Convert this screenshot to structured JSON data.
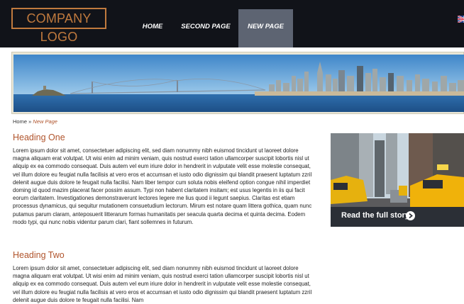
{
  "header": {
    "logo_text": "COMPANY LOGO",
    "nav": [
      {
        "label": "HOME",
        "active": false
      },
      {
        "label": "SECOND PAGE",
        "active": false
      },
      {
        "label": "NEW PAGE",
        "active": true
      }
    ],
    "language_icon": "uk-flag-icon"
  },
  "banner": {
    "image": "city-skyline-bay-bridge"
  },
  "breadcrumb": {
    "home": "Home",
    "separator": "»",
    "current": "New Page"
  },
  "content": {
    "heading_one": "Heading One",
    "paragraph_one": "Lorem ipsum dolor sit amet, consectetuer adipiscing elit, sed diam nonummy nibh euismod tincidunt ut laoreet dolore magna aliquam erat volutpat. Ut wisi enim ad minim veniam, quis nostrud exerci tation ullamcorper suscipit lobortis nisl ut aliquip ex ea commodo consequat. Duis autem vel eum iriure dolor in hendrerit in vulputate velit esse molestie consequat, vel illum dolore eu feugiat nulla facilisis at vero eros et accumsan et iusto odio dignissim qui blandit praesent luptatum zzril delenit augue duis dolore te feugait nulla facilisi. Nam liber tempor cum soluta nobis eleifend option congue nihil imperdiet doming id quod mazim placerat facer possim assum. Typi non habent claritatem insitam; est usus legentis in iis qui facit eorum claritatem. Investigationes demonstraverunt lectores legere me lius quod ii legunt saepius. Claritas est etiam processus dynamicus, qui sequitur mutationem consuetudium lectorum. Mirum est notare quam littera gothica, quam nunc putamus parum claram, anteposuerit litterarum formas humanitatis per seacula quarta decima et quinta decima. Eodem modo typi, qui nunc nobis videntur parum clari, fiant sollemnes in futurum.",
    "heading_two": "Heading Two",
    "paragraph_two": "Lorem ipsum dolor sit amet, consectetuer adipiscing elit, sed diam nonummy nibh euismod tincidunt ut laoreet dolore magna aliquam erat volutpat. Ut wisi enim ad minim veniam, quis nostrud exerci tation ullamcorper suscipit lobortis nisl ut aliquip ex ea commodo consequat. Duis autem vel eum iriure dolor in hendrerit in vulputate velit esse molestie consequat, vel illum dolore eu feugiat nulla facilisis at vero eros et accumsan et iusto odio dignissim qui blandit praesent luptatum zzril delenit augue duis dolore te feugait nulla facilisi. Nam"
  },
  "promo": {
    "image": "city-street-taxis",
    "caption": "Read the full story",
    "arrow_icon": "arrow-right-circle-icon"
  },
  "colors": {
    "header_bg": "#111319",
    "nav_active_bg": "#5d6472",
    "accent": "#b0542c",
    "logo": "#c07a3e",
    "caption_bg": "#2b2f36"
  }
}
